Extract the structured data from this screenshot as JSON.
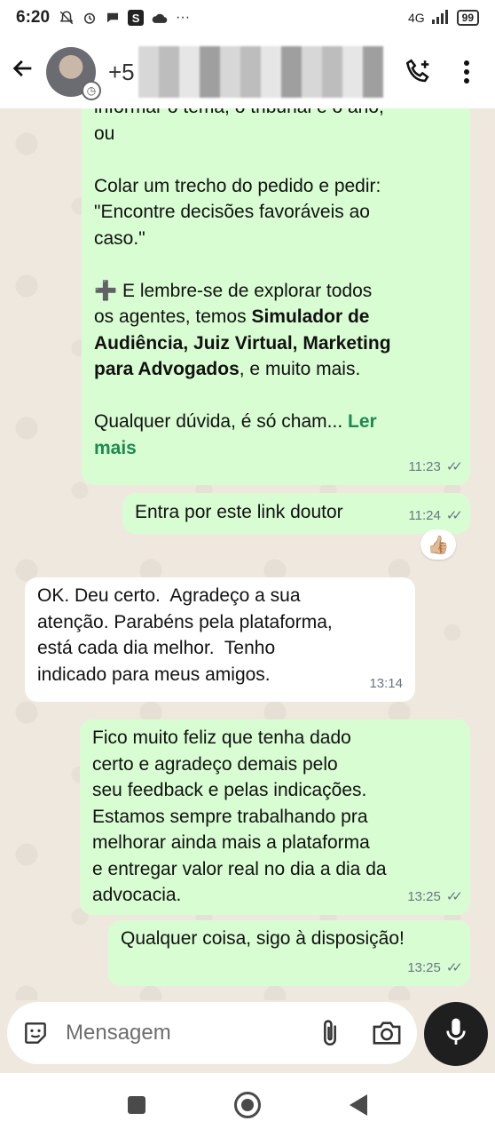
{
  "status_bar": {
    "time": "6:20",
    "network": "4G",
    "battery": "99",
    "more": "···"
  },
  "header": {
    "contact_prefix": "+5",
    "back_icon": "arrow-left-icon",
    "call_icon": "add-call-icon",
    "menu_icon": "kebab-menu-icon"
  },
  "messages": [
    {
      "id": "m1",
      "direction": "out",
      "text": "informar o tema, o tribunal e o ano,\nou\n\nColar um trecho do pedido e pedir:\n\"Encontre decisões favoráveis ao\ncaso.\"\n\n",
      "tip_emoji": "➕",
      "tip_text_1": " E lembre-se de explorar todos\nos agentes, temos ",
      "tip_bold": "Simulador de\nAudiência, Juiz Virtual, Marketing\npara Advogados",
      "tip_text_2": ", e muito mais.\n\n",
      "closing": "Qualquer dúvida, é só cham... ",
      "read_more": "Ler\nmais",
      "time": "11:23",
      "ticks": "✓✓"
    },
    {
      "id": "m2",
      "direction": "out",
      "text": "Entra por este link doutor",
      "time": "11:24",
      "ticks": "✓✓",
      "reaction": "👍🏼"
    },
    {
      "id": "m3",
      "direction": "in",
      "text": "OK. Deu certo.  Agradeço a sua\natenção. Parabéns pela plataforma,\nestá cada dia melhor.  Tenho\nindicado para meus amigos.",
      "time": "13:14"
    },
    {
      "id": "m4",
      "direction": "out",
      "text": "Fico muito feliz que tenha dado\ncerto e agradeço demais pelo\nseu feedback e pelas indicações.\nEstamos sempre trabalhando pra\nmelhorar ainda mais a plataforma\ne entregar valor real no dia a dia da\nadvocacia.",
      "time": "13:25",
      "ticks": "✓✓"
    },
    {
      "id": "m5",
      "direction": "out",
      "text": "Qualquer coisa, sigo à disposição!",
      "time": "13:25",
      "ticks": "✓✓"
    }
  ],
  "composer": {
    "placeholder": "Mensagem",
    "emoji_icon": "sticker-icon",
    "attach_icon": "paperclip-icon",
    "camera_icon": "camera-icon",
    "mic_icon": "microphone-icon"
  },
  "colors": {
    "outgoing_bubble": "#d9fdd3",
    "incoming_bubble": "#ffffff",
    "chat_background": "#efe8de",
    "link_green": "#1e8a4f"
  }
}
